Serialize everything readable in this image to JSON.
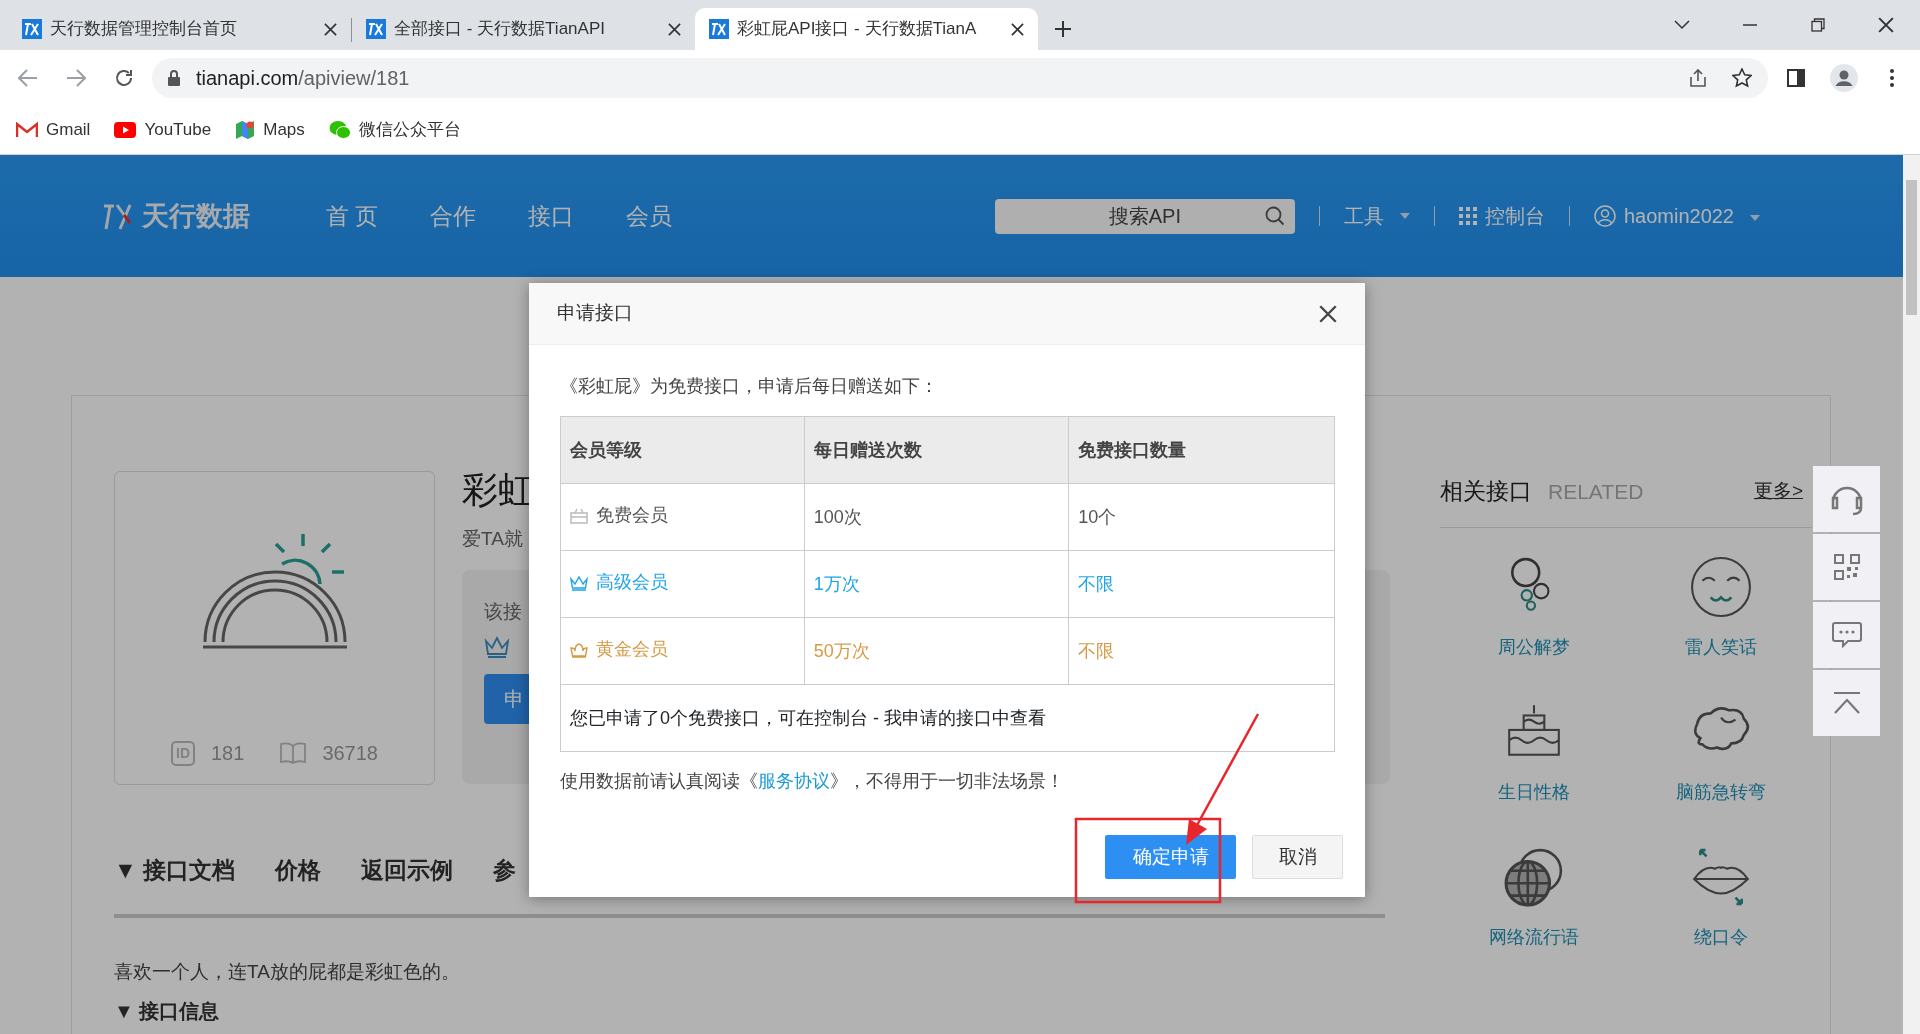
{
  "browser": {
    "tabs": [
      {
        "title": "天行数据管理控制台首页",
        "selected": false
      },
      {
        "title": "全部接口 - 天行数据TianAPI",
        "selected": false
      },
      {
        "title": "彩虹屁API接口 - 天行数据TianA",
        "selected": true
      }
    ],
    "url": "tianapi.com/apiview/181",
    "bookmarks": [
      {
        "label": "Gmail",
        "kind": "gmail"
      },
      {
        "label": "YouTube",
        "kind": "youtube"
      },
      {
        "label": "Maps",
        "kind": "maps"
      },
      {
        "label": "微信公众平台",
        "kind": "wechat"
      }
    ]
  },
  "site": {
    "logo": "天行数据",
    "nav": [
      "首 页",
      "合作",
      "接口",
      "会员"
    ],
    "search": {
      "placeholder": "搜索API"
    },
    "tools": "工具",
    "console": "控制台",
    "user": "haomin2022"
  },
  "api": {
    "title": "彩虹",
    "subtitle": "爱TA就",
    "id_badge": "ID",
    "id": "181",
    "views": "36718",
    "notice": "该接",
    "apply": "申",
    "tabs": [
      "▼ 接口文档",
      "价格",
      "返回示例",
      "参"
    ],
    "description": "喜欢一个人，连TA放的屁都是彩虹色的。",
    "section": "▼ 接口信息"
  },
  "related": {
    "title": "相关接口",
    "subtitle": "RELATED",
    "more": "更多>",
    "items": [
      {
        "label": "周公解梦",
        "kind": "bubbles"
      },
      {
        "label": "雷人笑话",
        "kind": "smile"
      },
      {
        "label": "生日性格",
        "kind": "cake"
      },
      {
        "label": "脑筋急转弯",
        "kind": "brain"
      },
      {
        "label": "网络流行语",
        "kind": "globe"
      },
      {
        "label": "绕口令",
        "kind": "lips"
      }
    ]
  },
  "modal": {
    "title": "申请接口",
    "intro": "《彩虹屁》为免费接口，申请后每日赠送如下：",
    "columns": [
      "会员等级",
      "每日赠送次数",
      "免费接口数量"
    ],
    "rows": [
      {
        "tier": "免费会员",
        "daily": "100次",
        "quota": "10个",
        "kind": "free",
        "color": "#555555"
      },
      {
        "tier": "高级会员",
        "daily": "1万次",
        "quota": "不限",
        "kind": "premium",
        "color": "#1ea5e8"
      },
      {
        "tier": "黄金会员",
        "daily": "50万次",
        "quota": "不限",
        "kind": "gold",
        "color": "#d69a45"
      }
    ],
    "note": "您已申请了0个免费接口，可在控制台 - 我申请的接口中查看",
    "terms_before": "使用数据前请认真阅读《",
    "terms_link": "服务协议",
    "terms_after": "》，不得用于一切非法场景！",
    "buttons": [
      {
        "label": "确定申请",
        "kind": "primary"
      },
      {
        "label": "取消",
        "kind": "secondary"
      }
    ]
  }
}
